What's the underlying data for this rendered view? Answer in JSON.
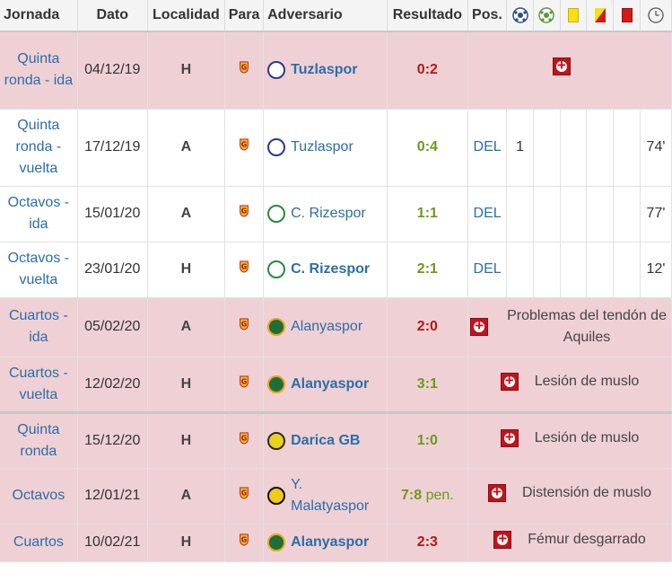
{
  "headers": {
    "jornada": "Jornada",
    "dato": "Dato",
    "localidad": "Localidad",
    "para": "Para",
    "adversario": "Adversario",
    "resultado": "Resultado",
    "pos": "Pos."
  },
  "header_icons": [
    "goals-ball-icon",
    "assists-ball-icon",
    "yellow-card-icon",
    "yellow-red-card-icon",
    "red-card-icon",
    "clock-icon"
  ],
  "colors": {
    "injured_row": "#efd0d4",
    "link": "#2a6ea8",
    "loss": "#b01919",
    "win": "#6a9a1c",
    "injury_icon": "#c0141c"
  },
  "rows": [
    {
      "jornada": "Quinta ronda - ida",
      "dato": "04/12/19",
      "loc": "H",
      "club": "Tuzlaspor",
      "emblem": "tuzla",
      "home": true,
      "res": "0:2",
      "res_type": "lose",
      "pen": "",
      "injured": true,
      "note": "",
      "pos": "",
      "goals": "",
      "min": ""
    },
    {
      "jornada": "Quinta ronda - vuelta",
      "dato": "17/12/19",
      "loc": "A",
      "club": "Tuzlaspor",
      "emblem": "tuzla",
      "home": false,
      "res": "0:4",
      "res_type": "win",
      "pen": "",
      "injured": false,
      "note": "",
      "pos": "DEL",
      "goals": "1",
      "min": "74'"
    },
    {
      "jornada": "Octavos - ida",
      "dato": "15/01/20",
      "loc": "A",
      "club": "C. Rizespor",
      "emblem": "rize",
      "home": false,
      "res": "1:1",
      "res_type": "draw",
      "pen": "",
      "injured": false,
      "note": "",
      "pos": "DEL",
      "goals": "",
      "min": "77'"
    },
    {
      "jornada": "Octavos - vuelta",
      "dato": "23/01/20",
      "loc": "H",
      "club": "C. Rizespor",
      "emblem": "rize",
      "home": true,
      "res": "2:1",
      "res_type": "win",
      "pen": "",
      "injured": false,
      "note": "",
      "pos": "DEL",
      "goals": "",
      "min": "12'"
    },
    {
      "jornada": "Cuartos - ida",
      "dato": "05/02/20",
      "loc": "A",
      "club": "Alanyaspor",
      "emblem": "alanya",
      "home": false,
      "res": "2:0",
      "res_type": "lose",
      "pen": "",
      "injured": true,
      "note": "Problemas del tendón de Aquiles",
      "pos": "",
      "goals": "",
      "min": ""
    },
    {
      "jornada": "Cuartos - vuelta",
      "dato": "12/02/20",
      "loc": "H",
      "club": "Alanyaspor",
      "emblem": "alanya",
      "home": true,
      "res": "3:1",
      "res_type": "win",
      "pen": "",
      "injured": true,
      "note": "Lesión de muslo",
      "pos": "",
      "goals": "",
      "min": ""
    },
    {
      "jornada": "Quinta ronda",
      "dato": "15/12/20",
      "loc": "H",
      "club": "Darica GB",
      "emblem": "darica",
      "home": true,
      "res": "1:0",
      "res_type": "win",
      "pen": "",
      "injured": true,
      "note": "Lesión de muslo",
      "pos": "",
      "goals": "",
      "min": "",
      "sep": true
    },
    {
      "jornada": "Octavos",
      "dato": "12/01/21",
      "loc": "A",
      "club": "Y. Malatyaspor",
      "emblem": "malatya",
      "home": false,
      "res": "7:8",
      "res_type": "win",
      "pen": "pen.",
      "injured": true,
      "note": "Distensión de muslo",
      "pos": "",
      "goals": "",
      "min": ""
    },
    {
      "jornada": "Cuartos",
      "dato": "10/02/21",
      "loc": "H",
      "club": "Alanyaspor",
      "emblem": "alanya",
      "home": true,
      "res": "2:3",
      "res_type": "lose",
      "pen": "",
      "injured": true,
      "note": "Fémur desgarrado",
      "pos": "",
      "goals": "",
      "min": ""
    }
  ]
}
